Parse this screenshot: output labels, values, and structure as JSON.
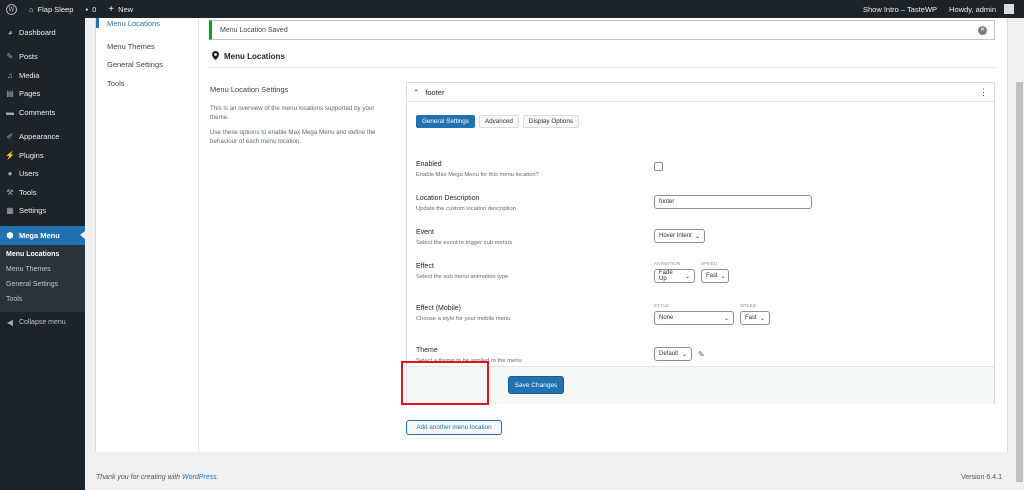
{
  "adminbar": {
    "site_name": "Flap Sleep",
    "comments_count": "0",
    "new_label": "New",
    "show_intro": "Show Intro – TasteWP",
    "howdy": "Howdy, admin"
  },
  "sidebar": {
    "items": [
      {
        "label": "Dashboard",
        "icon": "dashboard-icon"
      },
      {
        "label": "Posts",
        "icon": "pin-icon"
      },
      {
        "label": "Media",
        "icon": "media-icon"
      },
      {
        "label": "Pages",
        "icon": "pages-icon"
      },
      {
        "label": "Comments",
        "icon": "comment-icon"
      },
      {
        "label": "Appearance",
        "icon": "brush-icon"
      },
      {
        "label": "Plugins",
        "icon": "plugin-icon"
      },
      {
        "label": "Users",
        "icon": "user-icon"
      },
      {
        "label": "Tools",
        "icon": "wrench-icon"
      },
      {
        "label": "Settings",
        "icon": "settings-icon"
      },
      {
        "label": "Mega Menu",
        "icon": "mega-menu-icon"
      }
    ],
    "submenu": [
      "Menu Locations",
      "Menu Themes",
      "General Settings",
      "Tools"
    ],
    "collapse": "Collapse menu"
  },
  "subnav": [
    "Menu Locations",
    "Menu Themes",
    "General Settings",
    "Tools"
  ],
  "notice": "Menu Location Saved",
  "heading": "Menu Locations",
  "desc": {
    "title": "Menu Location Settings",
    "p1": "This is an overview of the menu locations supported by your theme.",
    "p2": "Use these options to enable Max Mega Menu and define the behaviour of each menu location."
  },
  "location": {
    "name": "footer",
    "tabs": [
      "General Settings",
      "Advanced",
      "Display Options"
    ],
    "enabled": {
      "label": "Enabled",
      "sub": "Enable Max Mega Menu for this menu location?"
    },
    "description": {
      "label": "Location Description",
      "sub": "Update the custom location description",
      "value": "footer"
    },
    "event": {
      "label": "Event",
      "sub": "Select the event to trigger sub menus",
      "value": "Hover Intent"
    },
    "effect": {
      "label": "Effect",
      "sub": "Select the sub menu animation type",
      "cap_anim": "ANIMATION",
      "cap_speed": "SPEED",
      "animation": "Fade Up",
      "speed": "Fast"
    },
    "effect_mobile": {
      "label": "Effect (Mobile)",
      "sub": "Choose a style for your mobile menu",
      "cap_style": "STYLE",
      "cap_speed": "SPEED",
      "style": "None",
      "speed": "Fast"
    },
    "theme": {
      "label": "Theme",
      "sub": "Select a theme to be applied to the menu",
      "value": "Default"
    },
    "save_label": "Save Changes"
  },
  "add_location": "Add another menu location",
  "footer": {
    "thanks": "Thank you for creating with",
    "wp_link": "WordPress.",
    "version": "Version 6.4.1"
  },
  "colors": {
    "accent": "#2271b1",
    "highlight": "#e0141e",
    "success": "#00a32a",
    "adminbar": "#1d2327"
  }
}
